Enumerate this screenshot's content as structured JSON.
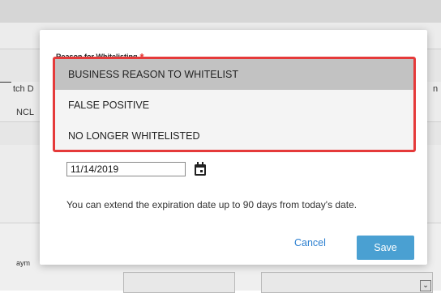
{
  "background": {
    "col_header_left": "tch D",
    "col_header_right": "n",
    "cell_left": "NCL",
    "row_label": "aym"
  },
  "modal": {
    "field_label": "Reason for Whitelisting",
    "required_marker": "*",
    "dropdown_options": [
      "BUSINESS REASON TO WHITELIST",
      "FALSE POSITIVE",
      "NO LONGER WHITELISTED"
    ],
    "selected_option": "BUSINESS REASON TO WHITELIST",
    "expiration_date": "11/14/2019",
    "help_text": "You can extend the expiration date up to 90 days from today's date.",
    "cancel_label": "Cancel",
    "save_label": "Save"
  },
  "icons": {
    "calendar": "calendar-icon",
    "select_arrow": "chevron-down-icon"
  },
  "colors": {
    "highlight_border": "#e53a3a",
    "selected_option_bg": "#c2c2c2",
    "save_button": "#4aa0d2",
    "cancel_link": "#2b7fd0",
    "required_asterisk": "#e53935"
  }
}
